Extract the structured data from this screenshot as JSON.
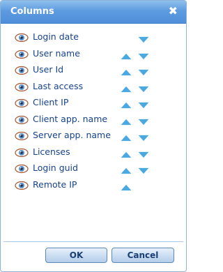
{
  "dialog": {
    "title": "Columns",
    "close_icon": "close-icon"
  },
  "columns": [
    {
      "label": "Login date",
      "up": false,
      "down": true
    },
    {
      "label": "User name",
      "up": true,
      "down": true
    },
    {
      "label": "User Id",
      "up": true,
      "down": true
    },
    {
      "label": "Last access",
      "up": true,
      "down": true
    },
    {
      "label": "Client IP",
      "up": true,
      "down": true
    },
    {
      "label": "Client app. name",
      "up": true,
      "down": true
    },
    {
      "label": "Server app. name",
      "up": true,
      "down": true
    },
    {
      "label": "Licenses",
      "up": true,
      "down": true
    },
    {
      "label": "Login guid",
      "up": true,
      "down": true
    },
    {
      "label": "Remote IP",
      "up": true,
      "down": false
    }
  ],
  "buttons": {
    "ok_label": "OK",
    "cancel_label": "Cancel"
  },
  "colors": {
    "title_bar": "#5d9be0",
    "label_text": "#15428b",
    "arrow": "#4aa9e0"
  }
}
